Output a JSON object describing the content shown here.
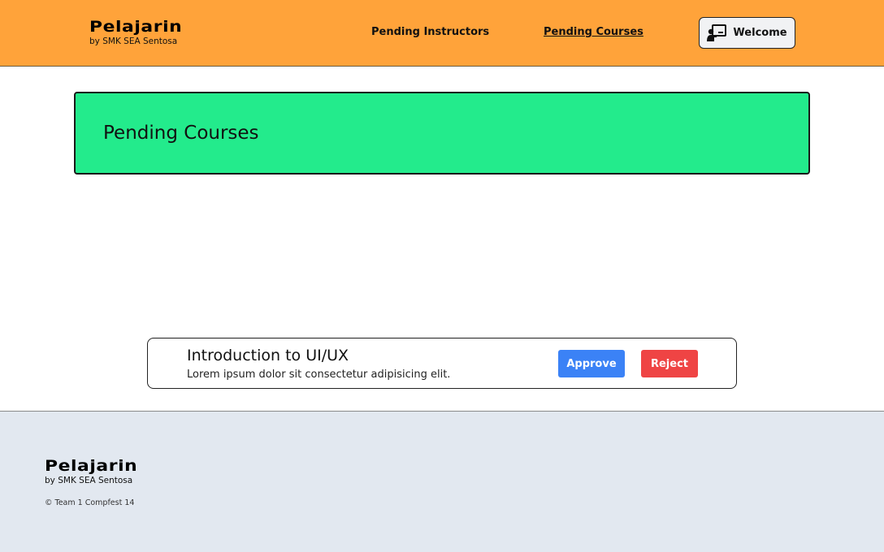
{
  "header": {
    "brand_name": "Pelajarin",
    "brand_sub": "by SMK SEA Sentosa",
    "nav": [
      {
        "label": "Pending Instructors"
      },
      {
        "label": "Pending Courses"
      }
    ],
    "welcome_label": "Welcome"
  },
  "main": {
    "page_title": "Pending Courses",
    "courses": [
      {
        "title": "Introduction to UI/UX",
        "description": "Lorem ipsum dolor sit consectetur adipisicing elit.",
        "approve_label": "Approve",
        "reject_label": "Reject"
      }
    ]
  },
  "footer": {
    "brand_name": "Pelajarin",
    "brand_sub": "by SMK SEA Sentosa",
    "copyright": "© Team 1 Compfest 14"
  },
  "colors": {
    "header_bg": "#ffa33a",
    "banner_bg": "#23eb8c",
    "approve": "#3b82f6",
    "reject": "#ef4444",
    "footer_bg": "#e2e8f0"
  },
  "icons": {
    "welcome": "teacher-board-icon"
  }
}
